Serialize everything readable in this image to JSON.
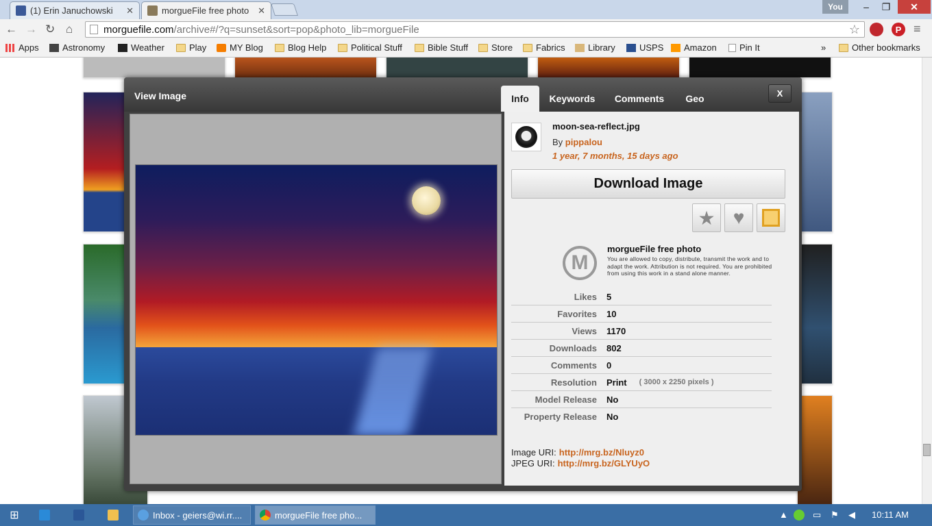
{
  "browser": {
    "tabs": [
      {
        "title": "(1) Erin Januchowski",
        "favicon": "facebook-icon"
      },
      {
        "title": "morgueFile free photo",
        "favicon": "morguefile-icon"
      }
    ],
    "profile_label": "You",
    "window_controls": {
      "minimize": "–",
      "maximize": "❐",
      "close": "✕"
    },
    "url_domain": "morguefile.com",
    "url_path": "/archive#/?q=sunset&sort=pop&photo_lib=morgueFile",
    "bookmarks": [
      "Apps",
      "Astronomy",
      "Weather",
      "Play",
      "MY Blog",
      "Blog Help",
      "Political Stuff",
      "Bible Stuff",
      "Store",
      "Fabrics",
      "Library",
      "USPS",
      "Amazon",
      "Pin It"
    ],
    "overflow": "»",
    "other_bookmarks": "Other bookmarks"
  },
  "modal": {
    "title": "View Image",
    "tabs": [
      "Info",
      "Keywords",
      "Comments",
      "Geo"
    ],
    "close_label": "X",
    "info": {
      "file_name": "moon-sea-reflect.jpg",
      "by_label": "By",
      "author": "pippalou",
      "age": "1 year, 7 months, 15 days ago",
      "download_label": "Download Image",
      "license_logo": "M",
      "license_title": "morgueFile free photo",
      "license_text": "You are allowed to copy, distribute, transmit the work and to adapt the work. Attribution is not required. You are prohibited from using this work in a stand alone manner.",
      "stats": [
        {
          "label": "Likes",
          "value": "5"
        },
        {
          "label": "Favorites",
          "value": "10"
        },
        {
          "label": "Views",
          "value": "1170"
        },
        {
          "label": "Downloads",
          "value": "802"
        },
        {
          "label": "Comments",
          "value": "0"
        },
        {
          "label": "Resolution",
          "value": "Print",
          "extra": "( 3000 x 2250 pixels )"
        },
        {
          "label": "Model Release",
          "value": "No"
        },
        {
          "label": "Property Release",
          "value": "No"
        }
      ],
      "image_uri_label": "Image URI:",
      "image_uri": "http://mrg.bz/Nluyz0",
      "jpeg_uri_label": "JPEG URI:",
      "jpeg_uri": "http://mrg.bz/GLYUyO"
    }
  },
  "taskbar": {
    "items": [
      "Inbox - geiers@wi.rr....",
      "morgueFile free pho..."
    ],
    "clock": "10:11 AM"
  },
  "colors": {
    "accent": "#c8641e",
    "modal_bg": "#404040",
    "taskbar": "#3a6ea5"
  }
}
